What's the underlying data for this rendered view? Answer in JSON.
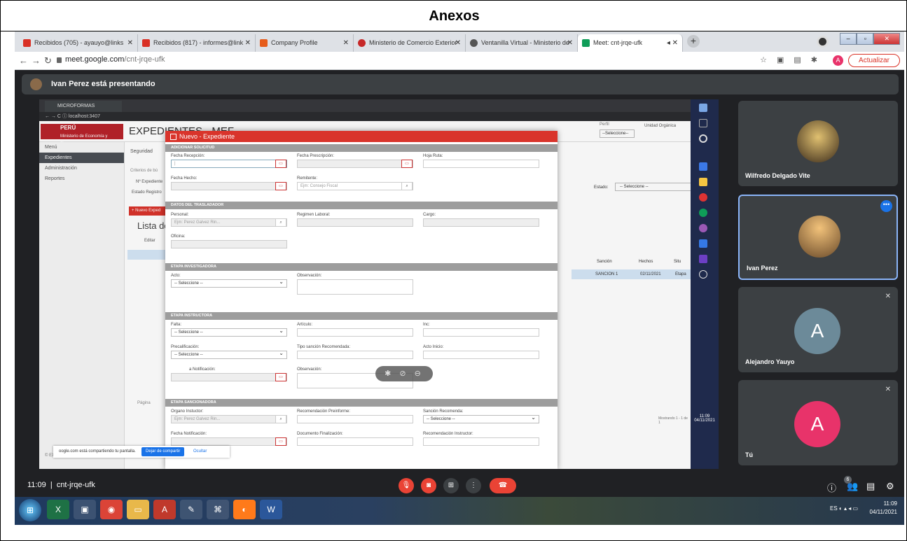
{
  "doc_title": "Anexos",
  "browser": {
    "tabs": [
      {
        "label": "Recibidos (705) - ayauyo@links",
        "color": "#d93025"
      },
      {
        "label": "Recibidos (817) - informes@link",
        "color": "#d93025"
      },
      {
        "label": "Company Profile",
        "color": "#e65c1b"
      },
      {
        "label": "Ministerio de Comercio Exterior",
        "color": "#c62828"
      },
      {
        "label": "Ventanilla Virtual - Ministerio de",
        "color": "#555555"
      },
      {
        "label": "Meet: cnt-jrqe-ufk",
        "color": "#0f9d58"
      }
    ],
    "url_host": "meet.google.com",
    "url_path": "/cnt-jrqe-ufk",
    "update_label": "Actualizar",
    "avatar_letter": "A"
  },
  "meet": {
    "presenter_text": "Ivan Perez está presentando",
    "time": "11:09",
    "meeting_code": "cnt-jrqe-ufk",
    "participants_count": "6",
    "participants": [
      {
        "name": "Wilfredo Delgado Vite",
        "type": "photo",
        "color": "#5a4a30"
      },
      {
        "name": "Ivan Perez",
        "type": "photo",
        "color": "#c98b3a"
      },
      {
        "name": "Alejandro Yauyo",
        "type": "letter",
        "letter": "A",
        "color": "#6c8a99"
      },
      {
        "name": "Tú",
        "type": "letter",
        "letter": "A",
        "color": "#e8336a"
      }
    ]
  },
  "shared": {
    "tab_title": "MICROFORMAS",
    "address": "localhost:3407",
    "logo_country": "PERÚ",
    "logo_ministry": "Ministerio de Economía y Finanzas",
    "app_title": "EXPEDIENTES - MEF",
    "sidebar": [
      "Menú",
      "Expedientes",
      "Administración",
      "Reportes"
    ],
    "sidebar_footer": "© EXPEDIENTES",
    "right": {
      "perfil": "Perfil",
      "perfil_select": "--Seleccione--",
      "unidad": "Unidad Orgánica",
      "estado_label": "Estado:",
      "estado_select": "-- Seleccione --",
      "col_sancion": "Sanción",
      "col_hechos": "Hechos",
      "col_situ": "Situ",
      "row_sancion": "SANCION 1",
      "row_fecha": "02/11/2021",
      "row_etapa": "Etapa",
      "footer": "Mostrando 1 - 1 de 1"
    },
    "bg": {
      "seguridad": "Seguridad",
      "criterios": "Criterios de bú",
      "nexp": "Nº Expediente",
      "estado_reg": "Estado Registro",
      "nuevo_btn": "+ Nuevo Exped",
      "lista": "Lista de",
      "editar": "Editar",
      "pagina": "Página"
    },
    "share_popup": {
      "text": "oogle.com está compartiendo tu pantalla.",
      "stop": "Dejar de compartir",
      "hide": "Ocultar"
    },
    "modal": {
      "title": "Nuevo - Expediente",
      "sections": {
        "s1": "ADICIONAR SOLICITUD",
        "s2": "DATOS DEL TRASLADADOR",
        "s3": "ETAPA INVESTIGADORA",
        "s4": "ETAPA INSTRUCTORA",
        "s5": "ETAPA SANCIONADORA"
      },
      "fields": {
        "fecha_recepcion": "Fecha Recepción:",
        "fecha_prescripcion": "Fecha Prescripción:",
        "hoja_ruta": "Hoja Ruta:",
        "fecha_hecho": "Fecha Hecho:",
        "remitente": "Remitente:",
        "remitente_ph": "Ejm: Consejo Fiscal",
        "personal": "Personal:",
        "personal_ph": "Ejm: Perez Galvez Rin...",
        "regimen": "Regimen Laboral:",
        "cargo": "Cargo:",
        "oficina": "Oficina:",
        "acto": "Acto:",
        "observacion": "Observación:",
        "falta": "Falta:",
        "articulo": "Artículo:",
        "inc": "Inc:",
        "precalificacion": "Precalificación:",
        "tipo_sancion": "Tipo sanción Recomendada:",
        "acto_inicio": "Acto Inicio:",
        "fecha_notificacion_i": "a Notificación:",
        "observacion2": "Observación:",
        "organo": "Organo Instuctor:",
        "organo_ph": "Ejm: Perez Galvez Rin...",
        "recomendacion": "Recomendación Preinforme:",
        "sancion_rec": "Sanción Recomenda:",
        "fecha_notificacion": "Fecha Notificación:",
        "doc_final": "Documento Finalización:",
        "rec_instructor": "Recomendación Instructor:",
        "select_default": "-- Seleccione --"
      }
    }
  },
  "taskbar": {
    "lang": "ES",
    "time": "11:09",
    "date": "04/11/2021"
  }
}
